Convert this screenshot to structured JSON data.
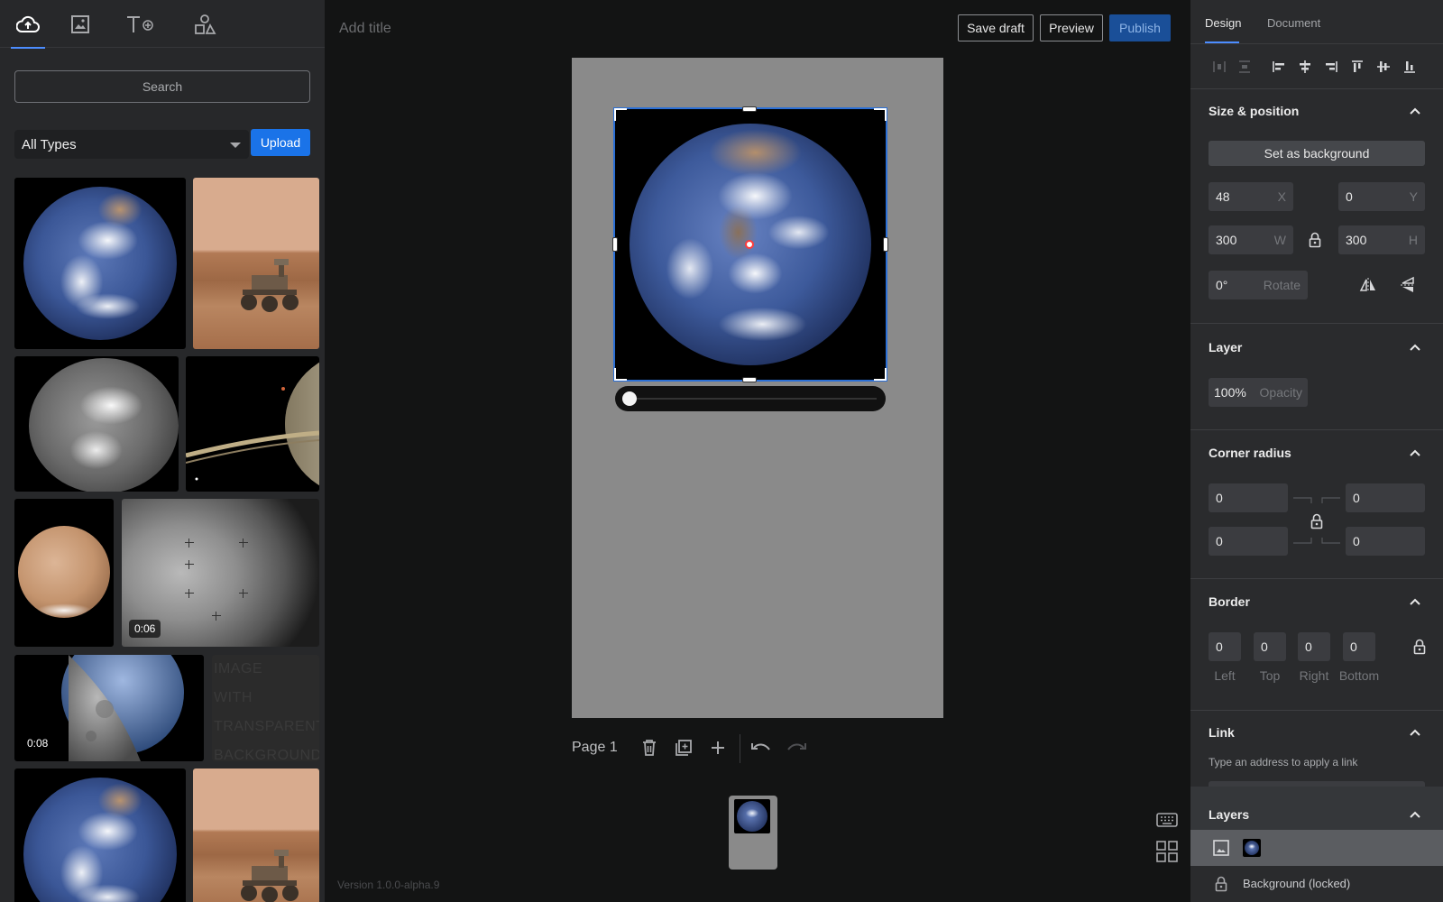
{
  "library": {
    "tabs": [
      {
        "name": "media-upload",
        "icon": "cloud-upload-icon"
      },
      {
        "name": "media-images",
        "icon": "image-icon"
      },
      {
        "name": "text",
        "icon": "text-add-icon"
      },
      {
        "name": "shapes",
        "icon": "shapes-icon"
      }
    ],
    "search_placeholder": "Search",
    "type_filter": "All Types",
    "upload_label": "Upload",
    "items": [
      {
        "kind": "earth"
      },
      {
        "kind": "mars-rover"
      },
      {
        "kind": "earth-gray"
      },
      {
        "kind": "saturn"
      },
      {
        "kind": "mars"
      },
      {
        "kind": "moon-video",
        "duration": "0:06"
      },
      {
        "kind": "lunar-earth-video",
        "duration": "0:08"
      },
      {
        "kind": "transparent",
        "lines": [
          "IMAGE",
          "WITH",
          "TRANSPARENT",
          "BACKGROUND"
        ]
      },
      {
        "kind": "earth"
      },
      {
        "kind": "mars-rover"
      }
    ]
  },
  "header": {
    "title_placeholder": "Add title",
    "save_draft": "Save draft",
    "preview": "Preview",
    "publish": "Publish"
  },
  "canvas": {
    "page_label": "Page 1",
    "video_progress": 0
  },
  "footer": {
    "version": "Version 1.0.0-alpha.9"
  },
  "panel": {
    "tabs": [
      "Design",
      "Document"
    ],
    "size_position": {
      "title": "Size & position",
      "set_background": "Set as background",
      "x": "48",
      "x_label": "X",
      "y": "0",
      "y_label": "Y",
      "w": "300",
      "w_label": "W",
      "h": "300",
      "h_label": "H",
      "rotate": "0°",
      "rotate_label": "Rotate"
    },
    "layer": {
      "title": "Layer",
      "opacity": "100%",
      "opacity_label": "Opacity"
    },
    "corner_radius": {
      "title": "Corner radius",
      "tl": "0",
      "tr": "0",
      "bl": "0",
      "br": "0"
    },
    "border": {
      "title": "Border",
      "left": "0",
      "top": "0",
      "right": "0",
      "bottom": "0",
      "left_label": "Left",
      "top_label": "Top",
      "right_label": "Right",
      "bottom_label": "Bottom"
    },
    "link": {
      "title": "Link",
      "hint": "Type an address to apply a link"
    },
    "layers": {
      "title": "Layers",
      "background": "Background (locked)"
    }
  },
  "colors": {
    "accent": "#1a73e8",
    "selection": "#2b6fd6",
    "panel_bg": "#2a2b2d",
    "library_bg": "#27282a",
    "workspace_bg": "#131414",
    "page_bg": "#8a8a8a"
  }
}
